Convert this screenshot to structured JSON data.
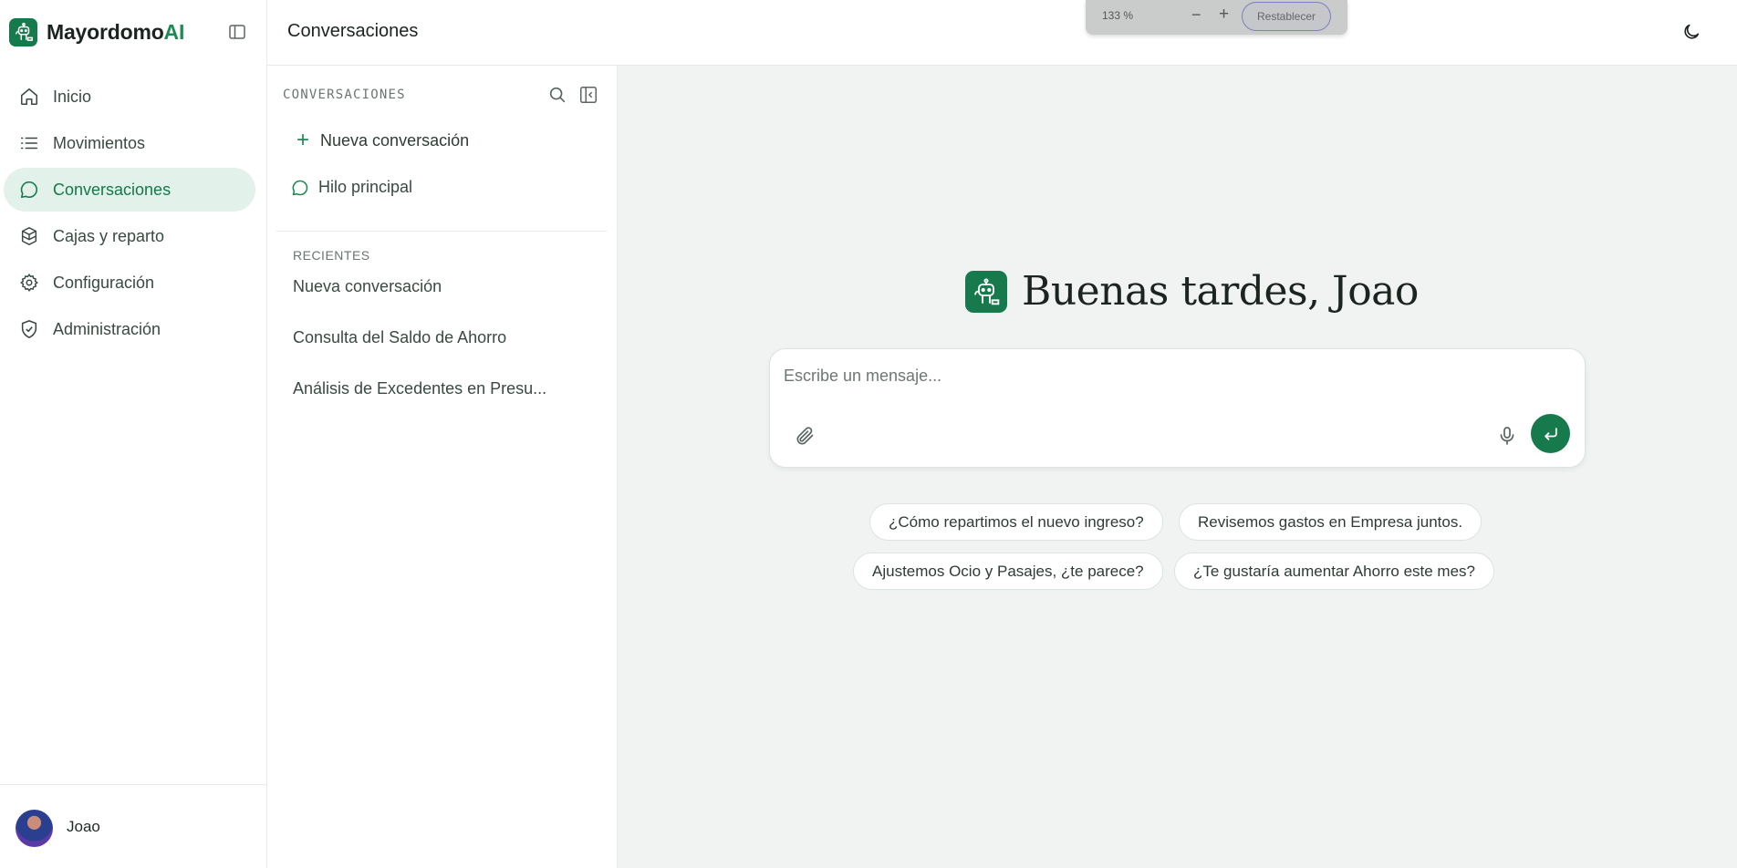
{
  "app": {
    "brand_name": "Mayordomo",
    "brand_suffix": "AI"
  },
  "sidebar": {
    "items": [
      {
        "label": "Inicio",
        "icon": "home-icon"
      },
      {
        "label": "Movimientos",
        "icon": "list-icon"
      },
      {
        "label": "Conversaciones",
        "icon": "chat-bubble-icon",
        "active": true
      },
      {
        "label": "Cajas y reparto",
        "icon": "boxes-icon"
      },
      {
        "label": "Configuración",
        "icon": "gear-icon"
      },
      {
        "label": "Administración",
        "icon": "shield-check-icon"
      }
    ],
    "user": {
      "name": "Joao"
    }
  },
  "header": {
    "title": "Conversaciones",
    "zoom": {
      "level": "133 %",
      "minus": "−",
      "plus": "+",
      "reset_label": "Restablecer"
    }
  },
  "conversations": {
    "heading": "CONVERSACIONES",
    "new_label": "Nueva conversación",
    "main_thread": "Hilo principal",
    "recent_heading": "RECIENTES",
    "recent": [
      "Nueva conversación",
      "Consulta del Saldo de Ahorro",
      "Análisis de Excedentes en Presu..."
    ]
  },
  "chat": {
    "greeting": "Buenas tardes, Joao",
    "input_placeholder": "Escribe un mensaje...",
    "suggestions": [
      "¿Cómo repartimos el nuevo ingreso?",
      "Revisemos gastos en Empresa juntos.",
      "Ajustemos Ocio y Pasajes, ¿te parece?",
      "¿Te gustaría aumentar Ahorro este mes?"
    ]
  },
  "colors": {
    "accent": "#177a4c",
    "active_bg": "#e2f1ea",
    "chat_bg": "#f0f3f2"
  }
}
